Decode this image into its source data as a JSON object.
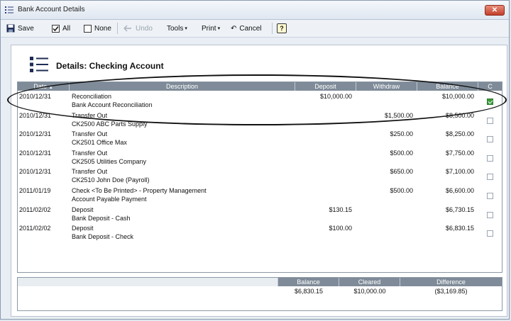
{
  "window": {
    "title": "Bank Account Details",
    "close_label": "✕"
  },
  "toolbar": {
    "save": "Save",
    "all": "All",
    "none": "None",
    "undo": "Undo",
    "tools": "Tools",
    "print": "Print",
    "cancel": "Cancel",
    "help": "?"
  },
  "page_title": "Details: Checking Account",
  "grid": {
    "columns": [
      "Date",
      "Description",
      "Deposit",
      "Withdraw",
      "Balance",
      "C"
    ],
    "rows": [
      {
        "date": "2010/12/31",
        "desc1": "Reconciliation",
        "desc2": "Bank Account Reconciliation",
        "deposit": "$10,000.00",
        "withdraw": "",
        "balance": "$10,000.00",
        "cleared": true
      },
      {
        "date": "2010/12/31",
        "desc1": "Transfer Out",
        "desc2": "CK2500 ABC Parts Supply",
        "deposit": "",
        "withdraw": "$1,500.00",
        "balance": "$8,500.00",
        "cleared": false
      },
      {
        "date": "2010/12/31",
        "desc1": "Transfer Out",
        "desc2": "CK2501 Office Max",
        "deposit": "",
        "withdraw": "$250.00",
        "balance": "$8,250.00",
        "cleared": false
      },
      {
        "date": "2010/12/31",
        "desc1": "Transfer Out",
        "desc2": "CK2505 Utilities Company",
        "deposit": "",
        "withdraw": "$500.00",
        "balance": "$7,750.00",
        "cleared": false
      },
      {
        "date": "2010/12/31",
        "desc1": "Transfer Out",
        "desc2": "CK2510 John Doe (Payroll)",
        "deposit": "",
        "withdraw": "$650.00",
        "balance": "$7,100.00",
        "cleared": false
      },
      {
        "date": "2011/01/19",
        "desc1": "Check <To Be Printed> - Property Management",
        "desc2": "Account Payable Payment",
        "deposit": "",
        "withdraw": "$500.00",
        "balance": "$6,600.00",
        "cleared": false
      },
      {
        "date": "2011/02/02",
        "desc1": "Deposit",
        "desc2": "Bank Deposit - Cash",
        "deposit": "$130.15",
        "withdraw": "",
        "balance": "$6,730.15",
        "cleared": false
      },
      {
        "date": "2011/02/02",
        "desc1": "Deposit",
        "desc2": "Bank Deposit - Check",
        "deposit": "$100.00",
        "withdraw": "",
        "balance": "$6,830.15",
        "cleared": false
      }
    ]
  },
  "summary": {
    "headers": [
      "Balance",
      "Cleared",
      "Difference"
    ],
    "values": [
      "$6,830.15",
      "$10,000.00",
      "($3,169.85)"
    ]
  }
}
